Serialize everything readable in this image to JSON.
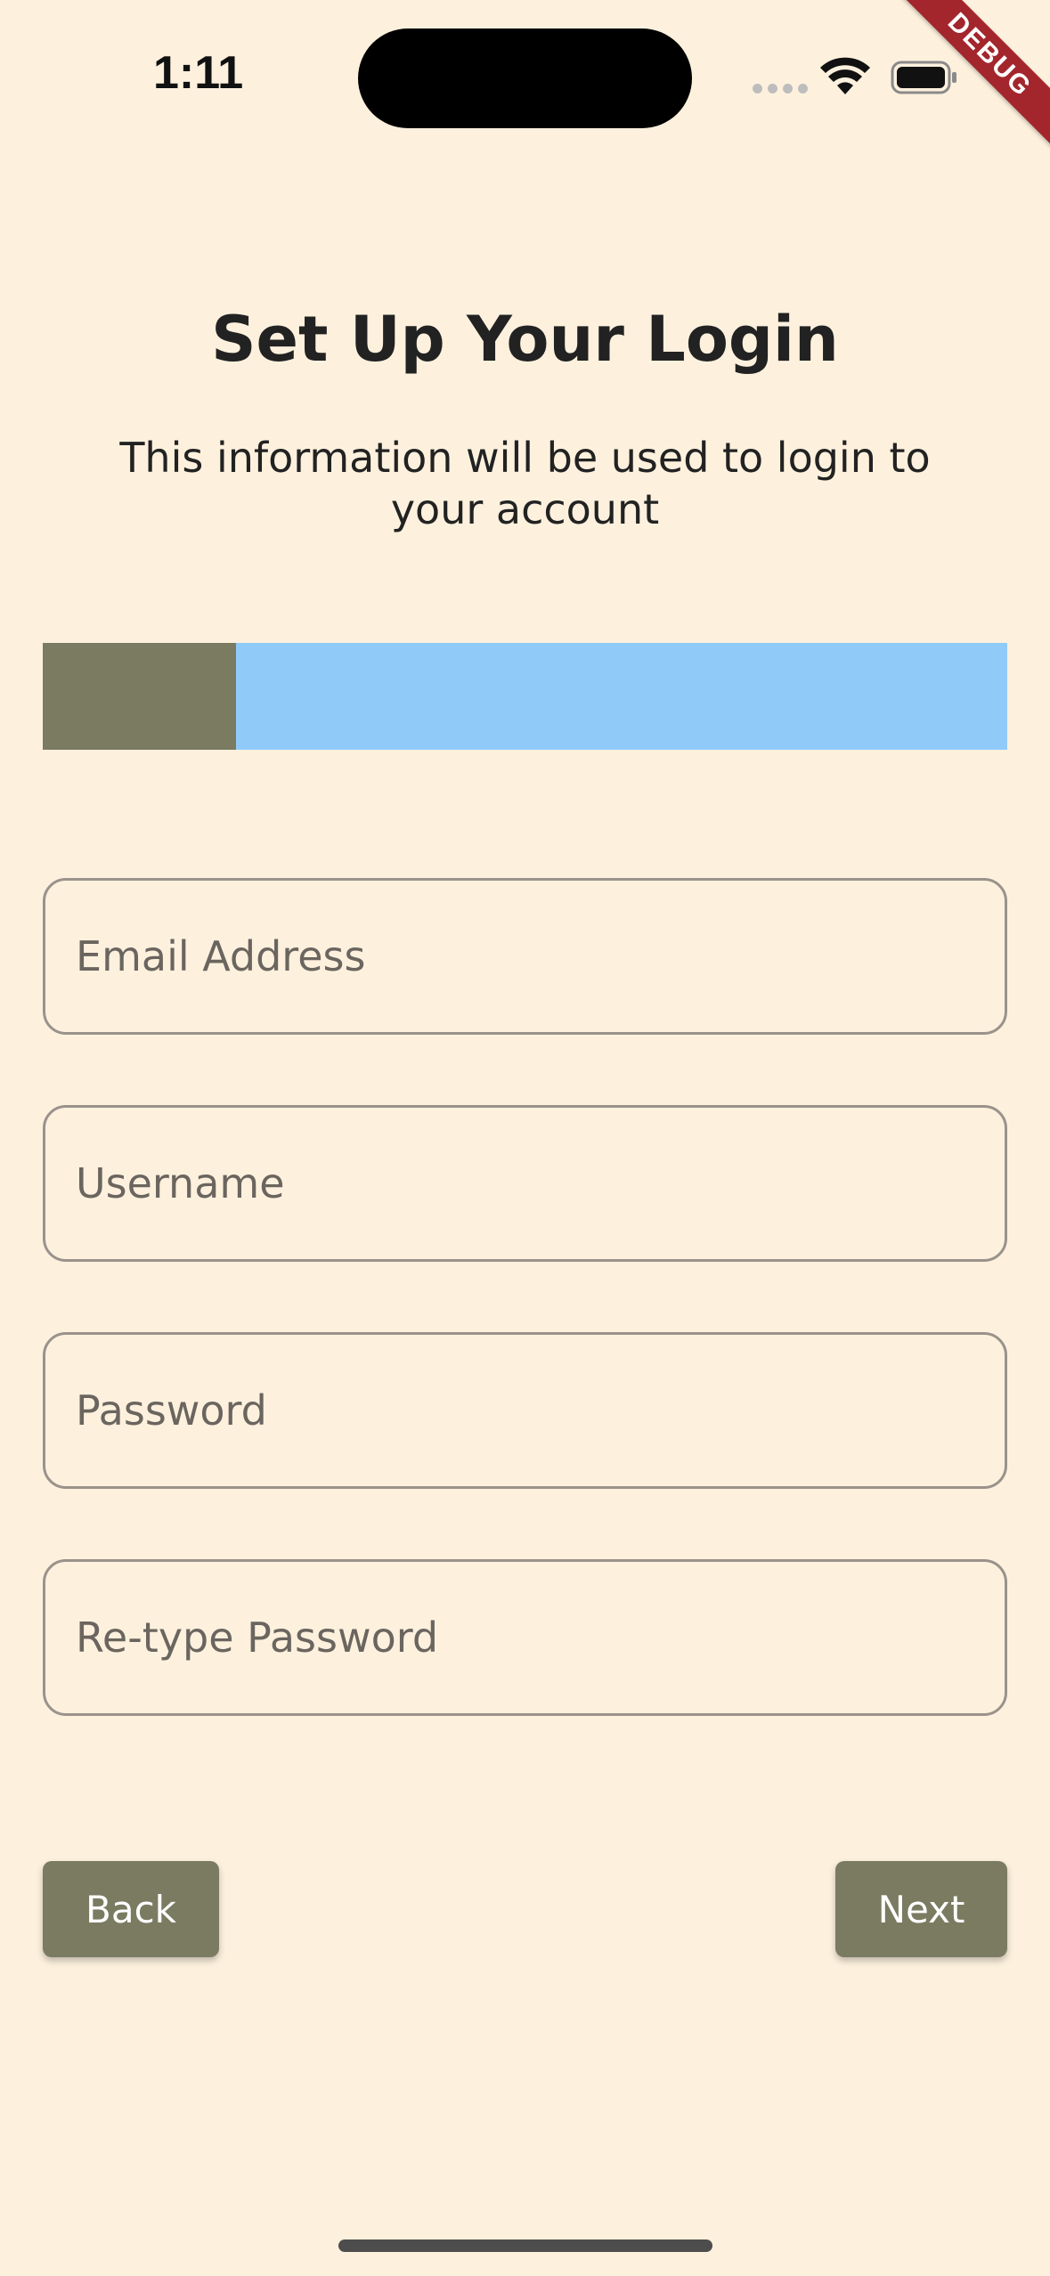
{
  "status_bar": {
    "time": "1:11"
  },
  "debug_banner": "DEBUG",
  "header": {
    "title": "Set Up Your Login",
    "subtitle": "This information will be used to login to your account"
  },
  "progress": {
    "fraction": 0.2,
    "fill_color": "#7A7B61",
    "track_color": "#90CAF9"
  },
  "form": {
    "email": {
      "value": "",
      "placeholder": "Email Address"
    },
    "username": {
      "value": "",
      "placeholder": "Username"
    },
    "password": {
      "value": "",
      "placeholder": "Password"
    },
    "retype_password": {
      "value": "",
      "placeholder": "Re-type Password"
    }
  },
  "buttons": {
    "back_label": "Back",
    "next_label": "Next"
  },
  "colors": {
    "background": "#FDF1DE",
    "button": "#7A7B61",
    "field_border": "#9A928B",
    "debug_ribbon": "#A3262C"
  },
  "icons": {
    "wifi": "wifi-icon",
    "battery": "battery-icon",
    "signal": "cellular-signal-icon"
  }
}
